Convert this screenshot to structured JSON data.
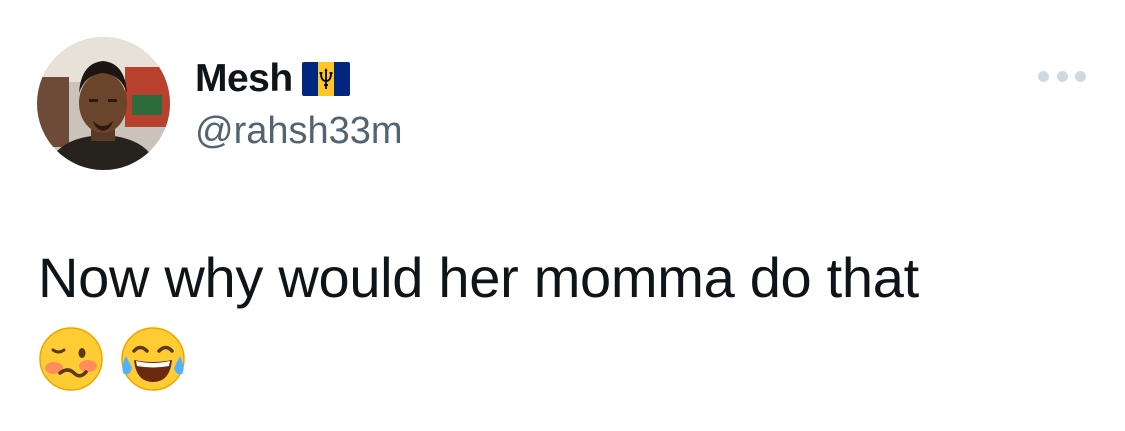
{
  "author": {
    "display_name": "Mesh",
    "handle": "@rahsh33m",
    "flag_icon": "barbados-flag-icon",
    "avatar_icon": "profile-photo"
  },
  "more_icon": "more-options-icon",
  "tweet": {
    "text": "Now why would her momma do that",
    "emojis": [
      "woozy-face-icon",
      "face-with-tears-of-joy-icon"
    ]
  },
  "colors": {
    "text": "#0f1419",
    "secondary": "#536471",
    "icon_gray": "#cfd9de",
    "flag_blue": "#00267f",
    "flag_gold": "#ffc726"
  }
}
